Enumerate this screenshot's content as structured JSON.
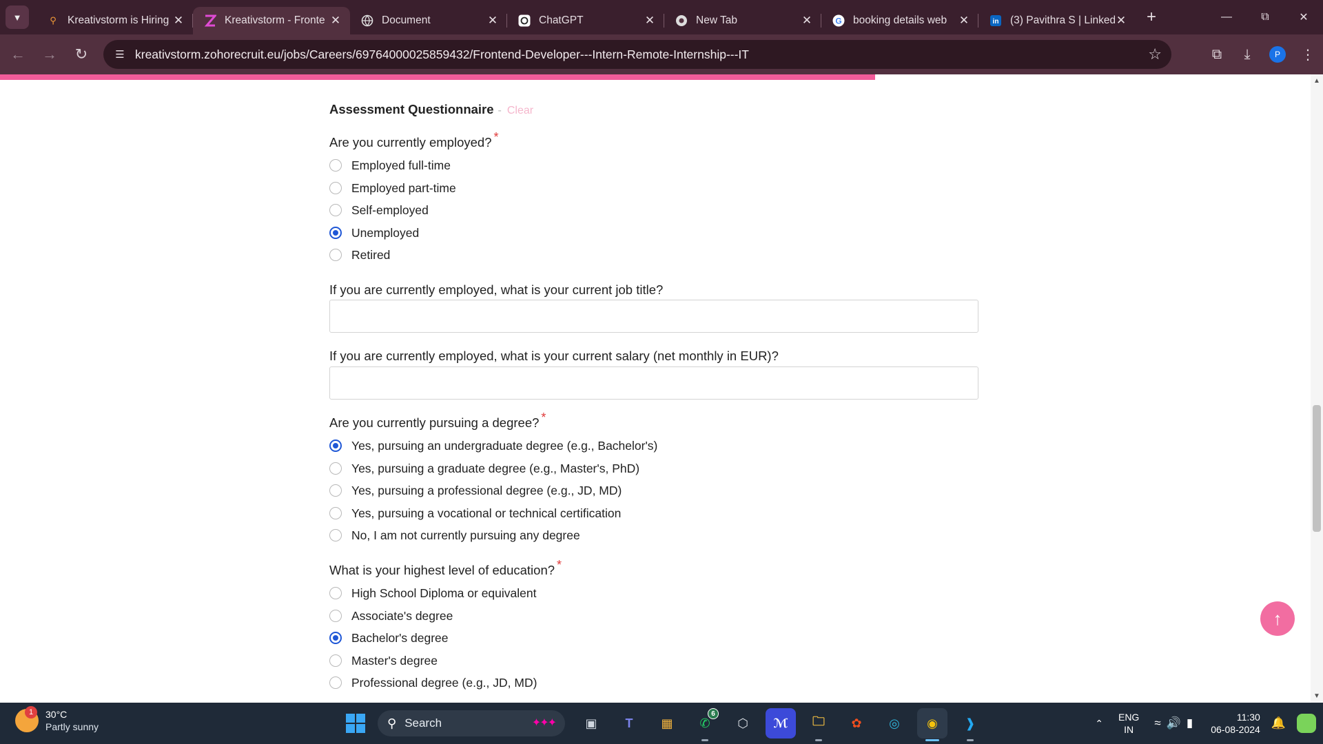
{
  "browser": {
    "tabs": [
      {
        "title": "Kreativstorm is Hiring",
        "icon": "search-favicon",
        "active": false
      },
      {
        "title": "Kreativstorm - Fronte",
        "icon": "kreativstorm-favicon",
        "active": true
      },
      {
        "title": "Document",
        "icon": "globe-favicon",
        "active": false
      },
      {
        "title": "ChatGPT",
        "icon": "chatgpt-favicon",
        "active": false
      },
      {
        "title": "New Tab",
        "icon": "chrome-favicon",
        "active": false
      },
      {
        "title": "booking details web",
        "icon": "google-favicon",
        "active": false
      },
      {
        "title": "(3) Pavithra S | Linked",
        "icon": "linkedin-favicon",
        "active": false
      }
    ],
    "url": "kreativstorm.zohorecruit.eu/jobs/Careers/69764000025859432/Frontend-Developer---Intern-Remote-Internship---IT",
    "profile_initial": "P"
  },
  "form": {
    "section_title": "Assessment Questionnaire",
    "section_sep": "-",
    "clear_label": "Clear",
    "required_mark": "*",
    "q_employed": {
      "label": "Are you currently employed?",
      "options": [
        "Employed full-time",
        "Employed part-time",
        "Self-employed",
        "Unemployed",
        "Retired"
      ],
      "selected": "Unemployed"
    },
    "q_job_title": {
      "label": "If you are currently employed, what is your current job title?",
      "value": ""
    },
    "q_salary": {
      "label": "If you are currently employed, what is your current salary (net monthly in EUR)?",
      "value": ""
    },
    "q_degree": {
      "label": "Are you currently pursuing a degree?",
      "options": [
        "Yes, pursuing an undergraduate degree (e.g., Bachelor's)",
        "Yes, pursuing a graduate degree (e.g., Master's, PhD)",
        "Yes, pursuing a professional degree (e.g., JD, MD)",
        "Yes, pursuing a vocational or technical certification",
        "No, I am not currently pursuing any degree"
      ],
      "selected": "Yes, pursuing an undergraduate degree (e.g., Bachelor's)"
    },
    "q_education": {
      "label": "What is your highest level of education?",
      "options": [
        "High School Diploma or equivalent",
        "Associate's degree",
        "Bachelor's degree",
        "Master's degree",
        "Professional degree (e.g., JD, MD)"
      ],
      "selected": "Bachelor's degree"
    }
  },
  "taskbar": {
    "weather_temp": "30°C",
    "weather_cond": "Partly sunny",
    "weather_badge": "1",
    "search_label": "Search",
    "whatsapp_badge": "6",
    "lang_top": "ENG",
    "lang_bottom": "IN",
    "time": "11:30",
    "date": "06-08-2024"
  },
  "colors": {
    "accent_pink": "#f25c9a",
    "radio_blue": "#1f57d6",
    "required_red": "#e03a3a"
  }
}
